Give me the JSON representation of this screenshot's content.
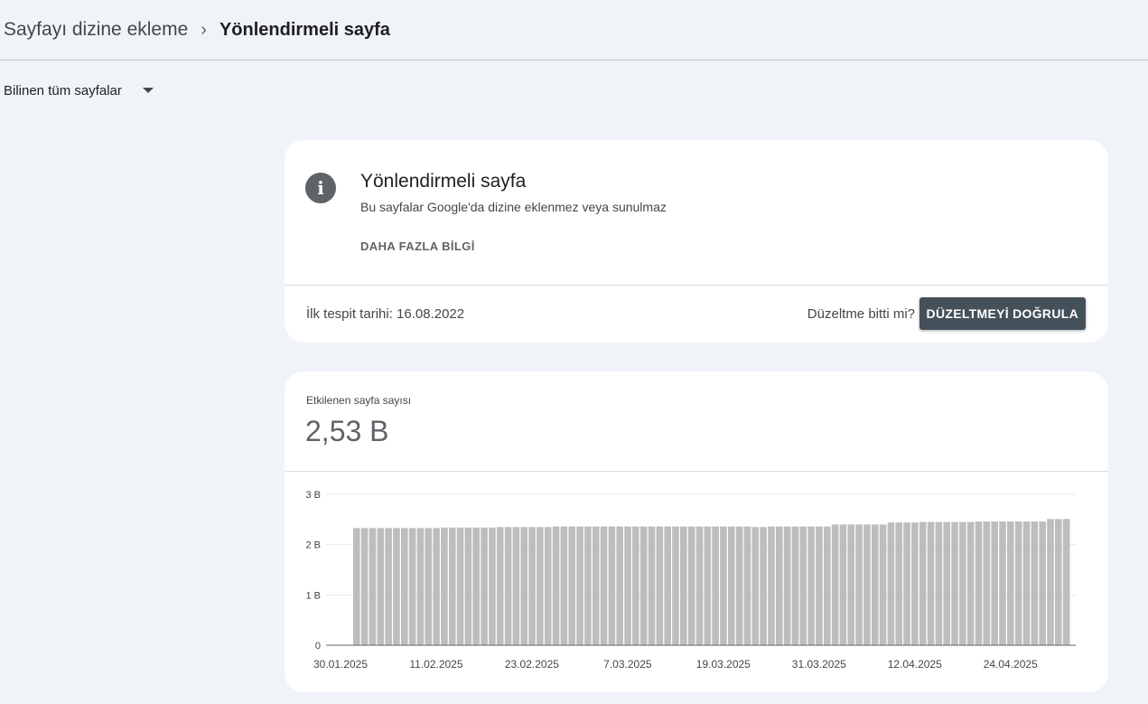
{
  "breadcrumb": {
    "parent": "Sayfayı dizine ekleme",
    "separator": "›",
    "current": "Yönlendirmeli sayfa"
  },
  "filter": {
    "selected": "Bilinen tüm sayfalar"
  },
  "info_card": {
    "icon": "info-icon",
    "title": "Yönlendirmeli sayfa",
    "subtitle": "Bu sayfalar Google'da dizine eklenmez veya sunulmaz",
    "more_link": "DAHA FAZLA BİLGİ",
    "first_detected": "İlk tespit tarihi: 16.08.2022",
    "fix_question": "Düzeltme bitti mi?",
    "validate_button": "DÜZELTMEYİ DOĞRULA"
  },
  "chart_card": {
    "label": "Etkilenen sayfa sayısı",
    "value": "2,53 B"
  },
  "colors": {
    "background": "#f0f4f9",
    "bar": "#bdbdbd",
    "button": "#44505a"
  },
  "chart_data": {
    "type": "bar",
    "ylabel": "",
    "xlabel": "",
    "ylim": [
      0,
      3
    ],
    "y_ticks": [
      {
        "value": 0,
        "label": "0"
      },
      {
        "value": 1,
        "label": "1 B"
      },
      {
        "value": 2,
        "label": "2 B"
      },
      {
        "value": 3,
        "label": "3 B"
      }
    ],
    "x_tick_labels": [
      {
        "index": 0,
        "label": "30.01.2025"
      },
      {
        "index": 12,
        "label": "11.02.2025"
      },
      {
        "index": 24,
        "label": "23.02.2025"
      },
      {
        "index": 36,
        "label": "7.03.2025"
      },
      {
        "index": 48,
        "label": "19.03.2025"
      },
      {
        "index": 60,
        "label": "31.03.2025"
      },
      {
        "index": 72,
        "label": "12.04.2025"
      },
      {
        "index": 84,
        "label": "24.04.2025"
      }
    ],
    "start_date": "30.01.2025",
    "values": [
      2.33,
      2.33,
      2.33,
      2.33,
      2.33,
      2.33,
      2.33,
      2.33,
      2.33,
      2.33,
      2.33,
      2.34,
      2.34,
      2.34,
      2.34,
      2.34,
      2.34,
      2.34,
      2.35,
      2.35,
      2.35,
      2.35,
      2.35,
      2.35,
      2.35,
      2.36,
      2.36,
      2.36,
      2.36,
      2.36,
      2.36,
      2.36,
      2.36,
      2.36,
      2.36,
      2.36,
      2.36,
      2.36,
      2.36,
      2.36,
      2.36,
      2.36,
      2.36,
      2.36,
      2.36,
      2.36,
      2.36,
      2.36,
      2.36,
      2.36,
      2.35,
      2.35,
      2.36,
      2.36,
      2.36,
      2.36,
      2.36,
      2.36,
      2.36,
      2.36,
      2.4,
      2.4,
      2.4,
      2.4,
      2.4,
      2.4,
      2.4,
      2.44,
      2.44,
      2.44,
      2.44,
      2.45,
      2.45,
      2.45,
      2.45,
      2.45,
      2.45,
      2.45,
      2.46,
      2.46,
      2.46,
      2.46,
      2.46,
      2.46,
      2.46,
      2.46,
      2.46,
      2.51,
      2.51,
      2.51
    ]
  }
}
